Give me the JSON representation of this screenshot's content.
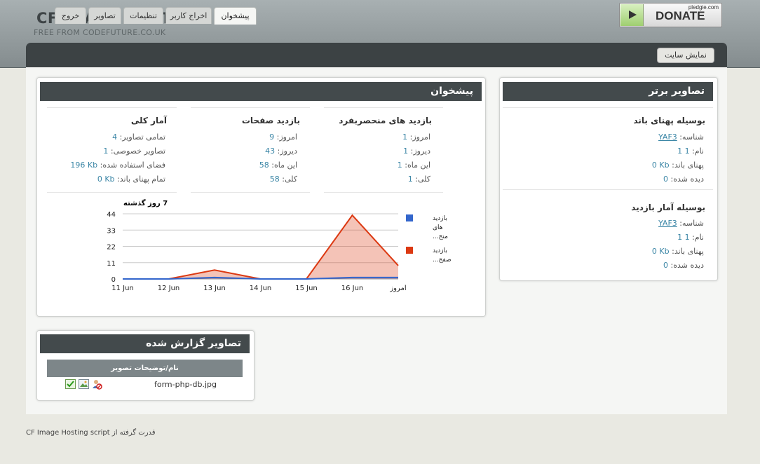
{
  "header": {
    "title": "CF IMAGE HOST",
    "subtitle": "FREE FROM CODEFUTURE.CO.UK",
    "donate_label": "DONATE",
    "donate_site": "pledgie.com"
  },
  "nav": {
    "tabs": [
      {
        "label": "پیشخوان",
        "active": true
      },
      {
        "label": "اخراج کاربر"
      },
      {
        "label": "تنظیمات"
      },
      {
        "label": "تصاویر"
      },
      {
        "label": "خروج"
      }
    ],
    "view_site": "نمایش سایت"
  },
  "dashboard": {
    "title": "پیشخوان",
    "unique_visits": {
      "heading": "بازدید های منحصربفرد",
      "today_label": "امروز:",
      "today": "1",
      "yesterday_label": "دیروز:",
      "yesterday": "1",
      "month_label": "این ماه:",
      "month": "1",
      "total_label": "کلی:",
      "total": "1"
    },
    "page_visits": {
      "heading": "بازدید صفحات",
      "today_label": "امروز:",
      "today": "9",
      "yesterday_label": "دیروز:",
      "yesterday": "43",
      "month_label": "این ماه:",
      "month": "58",
      "total_label": "کلی:",
      "total": "58"
    },
    "overall": {
      "heading": "آمار کلی",
      "all_images_label": "تمامی تصاویر:",
      "all_images": "4",
      "private_label": "تصاویر خصوصی:",
      "private": "1",
      "space_label": "فضای استفاده شده:",
      "space": "196 Kb",
      "bandwidth_label": "تمام پهنای باند:",
      "bandwidth": "0 Kb"
    }
  },
  "chart_data": {
    "type": "area",
    "title": "7 روز گذشته",
    "categories": [
      "11 Jun",
      "12 Jun",
      "13 Jun",
      "14 Jun",
      "15 Jun",
      "16 Jun",
      "امروز"
    ],
    "y_ticks": [
      "0",
      "11",
      "22",
      "33",
      "44"
    ],
    "ylim": [
      0,
      44
    ],
    "grid": true,
    "legend_position": "right",
    "series": [
      {
        "name": "بازدید های منح...",
        "legend_lines": [
          "بازدید",
          "های",
          "منح..."
        ],
        "color": "#3366cc",
        "values": [
          0,
          0,
          1,
          0,
          0,
          1,
          1
        ]
      },
      {
        "name": "بازدید صفح...",
        "legend_lines": [
          "بازدید",
          "صفح..."
        ],
        "color": "#dc3912",
        "values": [
          0,
          0,
          6,
          0,
          0,
          43,
          9
        ]
      }
    ]
  },
  "top_images": {
    "title": "تصاویر برتر",
    "by_bandwidth": {
      "heading": "بوسیله پهنای باند",
      "id_label": "شناسه:",
      "id": "YAF3",
      "name_label": "نام:",
      "name": "1 1",
      "bandwidth_label": "پهنای باند:",
      "bandwidth": "0 Kb",
      "views_label": "دیده شده:",
      "views": "0"
    },
    "by_views": {
      "heading": "بوسیله آمار بازدید",
      "id_label": "شناسه:",
      "id": "YAF3",
      "name_label": "نام:",
      "name": "1 1",
      "bandwidth_label": "پهنای باند:",
      "bandwidth": "0 Kb",
      "views_label": "دیده شده:",
      "views": "0"
    }
  },
  "reported": {
    "title": "تصاویر گزارش شده",
    "column_header": "نام/توضیحات تصویر",
    "rows": [
      {
        "filename": "form-php-db.jpg",
        "icons": [
          "approve-icon",
          "image-icon",
          "ban-user-icon"
        ]
      }
    ]
  },
  "footer": {
    "powered_by": "قدرت گرفته از",
    "script_name": "CF Image Hosting script"
  }
}
